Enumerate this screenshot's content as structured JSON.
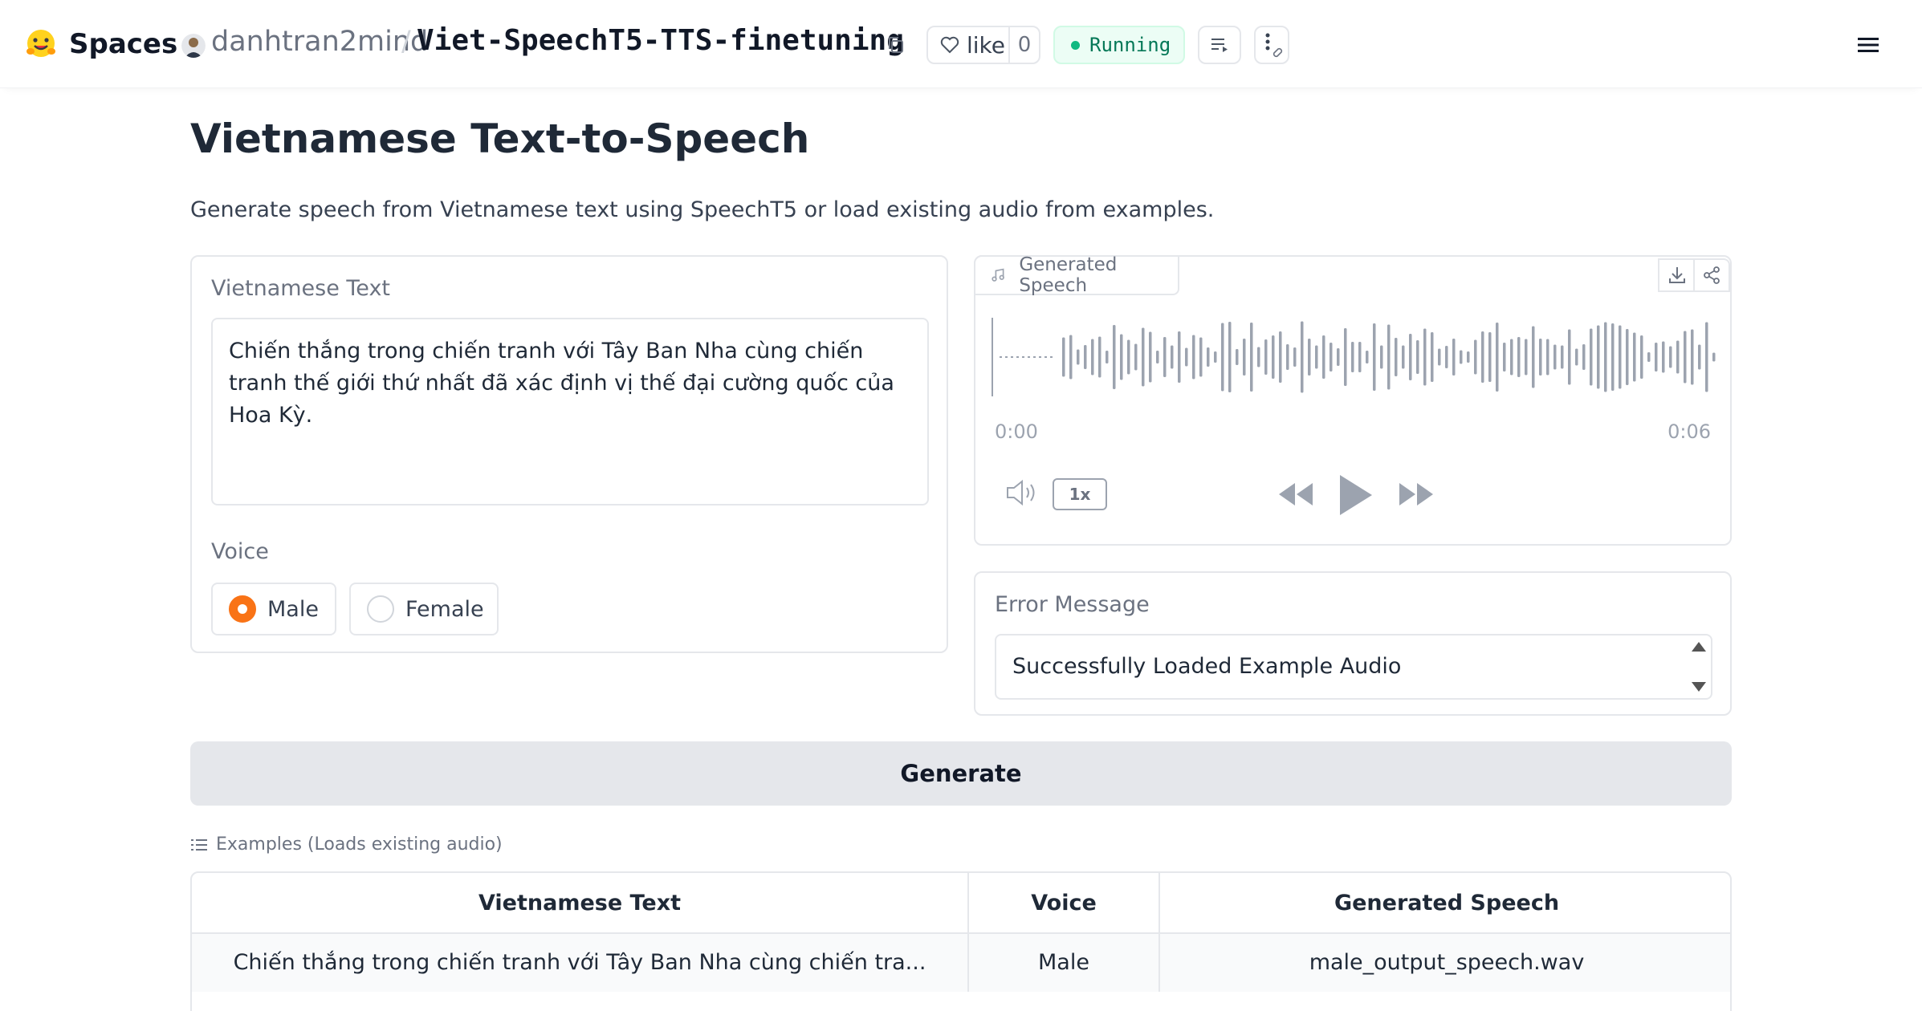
{
  "header": {
    "brand": "Spaces",
    "owner": "danhtran2mind",
    "separator": "/",
    "repo": "Viet-SpeechT5-TTS-finetuning",
    "like_label": "like",
    "like_count": "0",
    "status": "Running",
    "status_color": "#10b981"
  },
  "main": {
    "title": "Vietnamese Text-to-Speech",
    "description": "Generate speech from Vietnamese text using SpeechT5 or load existing audio from examples."
  },
  "input": {
    "label": "Vietnamese Text",
    "value": "Chiến thắng trong chiến tranh với Tây Ban Nha cùng chiến tranh thế giới thứ nhất đã xác định vị thế đại cường quốc của Hoa Kỳ."
  },
  "voice": {
    "label": "Voice",
    "options": [
      "Male",
      "Female"
    ],
    "selected": "Male"
  },
  "audio": {
    "label": "Generated Speech",
    "time_start": "0:00",
    "time_end": "0:06",
    "playback_rate": "1x"
  },
  "error": {
    "label": "Error Message",
    "value": "Successfully Loaded Example Audio"
  },
  "generate_label": "Generate",
  "examples": {
    "label": "Examples (Loads existing audio)",
    "columns": [
      "Vietnamese Text",
      "Voice",
      "Generated Speech"
    ],
    "rows": [
      [
        "Chiến thắng trong chiến tranh với Tây Ban Nha cùng chiến tra...",
        "Male",
        "male_output_speech.wav"
      ]
    ]
  },
  "colors": {
    "accent": "#f97316",
    "status_bg": "#ecfdf5",
    "button_bg": "#e5e7eb"
  }
}
